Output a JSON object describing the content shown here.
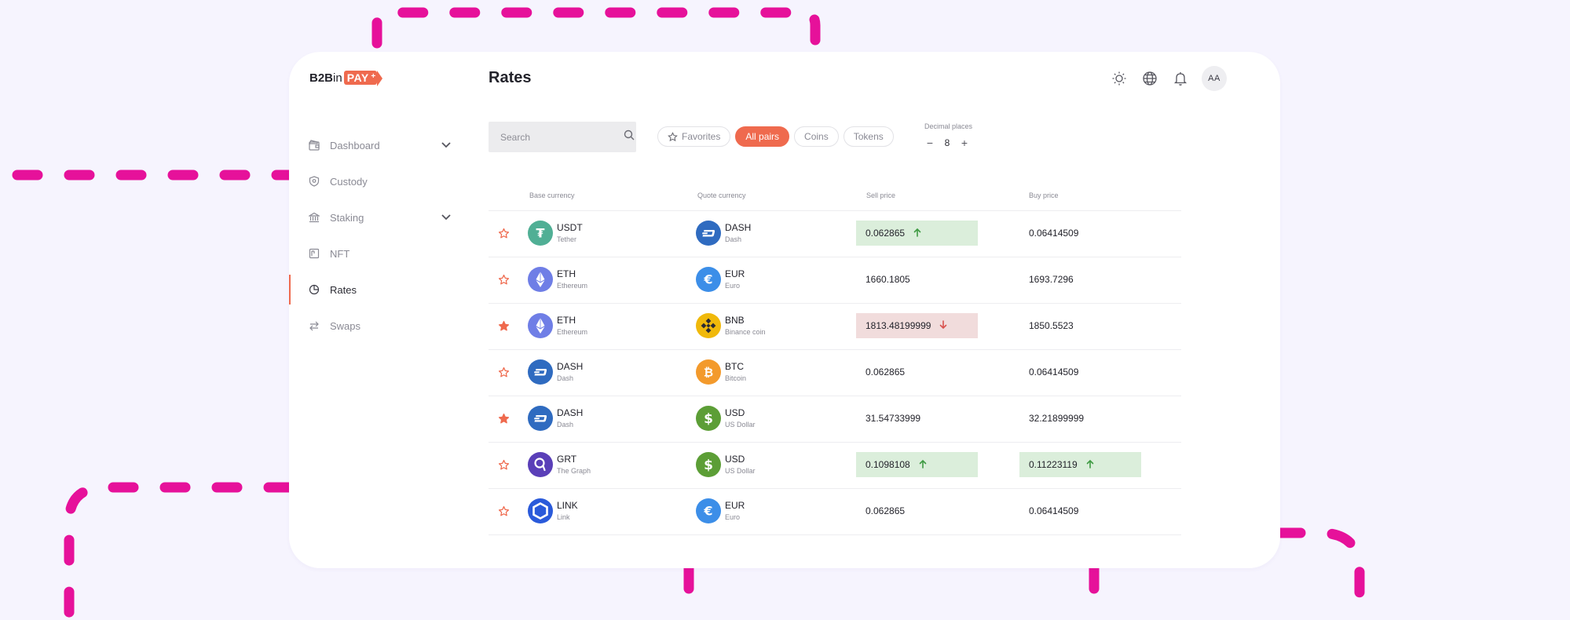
{
  "app": {
    "logo_b2b": "B2B",
    "logo_in": "in",
    "logo_pay": "PAY",
    "logo_plus": "+",
    "page_title": "Rates",
    "avatar_initials": "AA"
  },
  "sidebar": {
    "items": [
      {
        "label": "Dashboard",
        "icon": "wallet-icon",
        "expandable": true
      },
      {
        "label": "Custody",
        "icon": "shield-icon",
        "expandable": false
      },
      {
        "label": "Staking",
        "icon": "bank-icon",
        "expandable": true
      },
      {
        "label": "NFT",
        "icon": "image-icon",
        "expandable": false
      },
      {
        "label": "Rates",
        "icon": "pie-chart-icon",
        "expandable": false,
        "active": true
      },
      {
        "label": "Swaps",
        "icon": "swap-icon",
        "expandable": false
      }
    ]
  },
  "header": {
    "icons": [
      "sun-icon",
      "globe-icon",
      "bell-icon"
    ]
  },
  "filters": {
    "search_placeholder": "Search",
    "tabs": [
      {
        "label": "Favorites",
        "active": false
      },
      {
        "label": "All pairs",
        "active": true
      },
      {
        "label": "Coins",
        "active": false
      },
      {
        "label": "Tokens",
        "active": false
      }
    ],
    "decimal_label": "Decimal places",
    "decimal_minus": "−",
    "decimal_value": "8",
    "decimal_plus": "+"
  },
  "table": {
    "columns": [
      "Base currency",
      "Quote currency",
      "Sell price",
      "Buy price"
    ],
    "rows": [
      {
        "favorite": false,
        "base": {
          "code": "USDT",
          "name": "Tether"
        },
        "quote": {
          "code": "DASH",
          "name": "Dash"
        },
        "sell": "0.062865",
        "sell_trend": "up",
        "buy": "0.06414509",
        "buy_trend": ""
      },
      {
        "favorite": false,
        "base": {
          "code": "ETH",
          "name": "Ethereum"
        },
        "quote": {
          "code": "EUR",
          "name": "Euro"
        },
        "sell": "1660.1805",
        "sell_trend": "",
        "buy": "1693.7296",
        "buy_trend": ""
      },
      {
        "favorite": true,
        "base": {
          "code": "ETH",
          "name": "Ethereum"
        },
        "quote": {
          "code": "BNB",
          "name": "Binance coin"
        },
        "sell": "1813.48199999",
        "sell_trend": "down",
        "buy": "1850.5523",
        "buy_trend": ""
      },
      {
        "favorite": false,
        "base": {
          "code": "DASH",
          "name": "Dash"
        },
        "quote": {
          "code": "BTC",
          "name": "Bitcoin"
        },
        "sell": "0.062865",
        "sell_trend": "",
        "buy": "0.06414509",
        "buy_trend": ""
      },
      {
        "favorite": true,
        "base": {
          "code": "DASH",
          "name": "Dash"
        },
        "quote": {
          "code": "USD",
          "name": "US Dollar"
        },
        "sell": "31.54733999",
        "sell_trend": "",
        "buy": "32.21899999",
        "buy_trend": ""
      },
      {
        "favorite": false,
        "base": {
          "code": "GRT",
          "name": "The Graph"
        },
        "quote": {
          "code": "USD",
          "name": "US Dollar"
        },
        "sell": "0.1098108",
        "sell_trend": "up",
        "buy": "0.11223119",
        "buy_trend": "up"
      },
      {
        "favorite": false,
        "base": {
          "code": "LINK",
          "name": "Link"
        },
        "quote": {
          "code": "EUR",
          "name": "Euro"
        },
        "sell": "0.062865",
        "sell_trend": "",
        "buy": "0.06414509",
        "buy_trend": ""
      }
    ]
  },
  "colors": {
    "accent": "#ef6a4e",
    "trend_up_bg": "#dbeedb",
    "trend_down_bg": "#f1dcdc",
    "trend_up_arrow": "#3f9b43",
    "trend_down_arrow": "#d9534f",
    "decoration": "#e6119a"
  }
}
